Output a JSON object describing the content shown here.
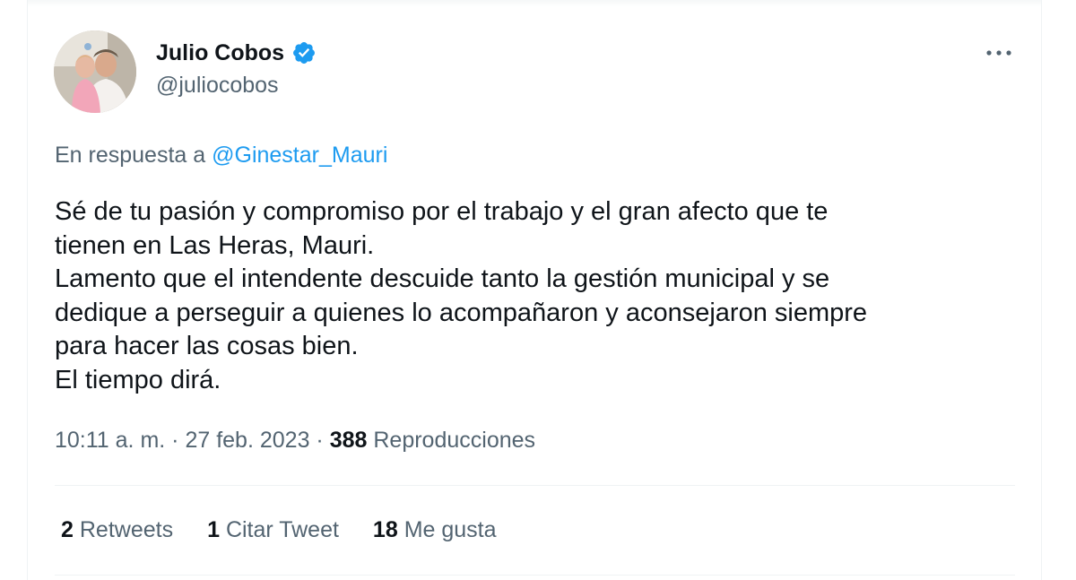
{
  "author": {
    "name": "Julio Cobos",
    "handle": "@juliocobos",
    "verified": true
  },
  "reply": {
    "prefix": "En respuesta a ",
    "to_handle": "@Ginestar_Mauri"
  },
  "tweet": {
    "lines": [
      "Sé de tu pasión y compromiso por el trabajo y el gran afecto que te",
      "tienen en Las Heras, Mauri.",
      "Lamento que el intendente descuide tanto la gestión municipal y se",
      "dedique a perseguir a quienes lo acompañaron y aconsejaron siempre",
      "para hacer las cosas bien.",
      "El tiempo dirá."
    ]
  },
  "meta": {
    "time": "10:11 a. m.",
    "separator": "·",
    "date": "27 feb. 2023",
    "views_count": "388",
    "views_label": "Reproducciones"
  },
  "stats": [
    {
      "count": "2",
      "label": "Retweets"
    },
    {
      "count": "1",
      "label": "Citar Tweet"
    },
    {
      "count": "18",
      "label": "Me gusta"
    }
  ],
  "colors": {
    "link": "#1d9bf0",
    "secondary_text": "#536471",
    "primary_text": "#0f1419",
    "divider": "#eff3f4"
  },
  "icons": {
    "verified": "verified-badge-icon",
    "more": "more-options-icon"
  }
}
